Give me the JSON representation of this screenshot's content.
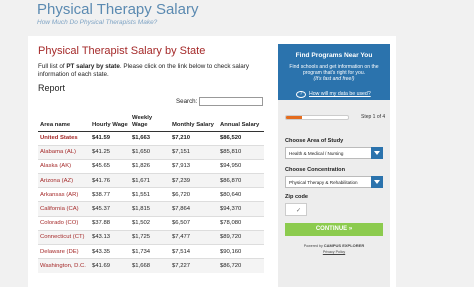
{
  "header": {
    "title": "Physical Therapy Salary",
    "subtitle": "How Much Do Physical Therapists Make?"
  },
  "article": {
    "heading": "Physical Therapist Salary by State",
    "intro_prefix": "Full list of ",
    "intro_bold": "PT salary by state",
    "intro_suffix": ". Please click on the link below to check salary information of each state.",
    "report_label": "Report",
    "search_label": "Search:",
    "search_value": ""
  },
  "table": {
    "columns": [
      "Area name",
      "Hourly Wage",
      "Weekly Wage",
      "Monthly Salary",
      "Annual Salary"
    ],
    "rows": [
      [
        "United States",
        "$41.59",
        "$1,663",
        "$7,210",
        "$86,520"
      ],
      [
        "Alabama (AL)",
        "$41.25",
        "$1,650",
        "$7,151",
        "$85,810"
      ],
      [
        "Alaska (AK)",
        "$45.65",
        "$1,826",
        "$7,913",
        "$94,950"
      ],
      [
        "Arizona (AZ)",
        "$41.76",
        "$1,671",
        "$7,239",
        "$86,870"
      ],
      [
        "Arkansas (AR)",
        "$38.77",
        "$1,551",
        "$6,720",
        "$80,640"
      ],
      [
        "California (CA)",
        "$45.37",
        "$1,815",
        "$7,864",
        "$94,370"
      ],
      [
        "Colorado (CO)",
        "$37.88",
        "$1,502",
        "$6,507",
        "$78,080"
      ],
      [
        "Connecticut (CT)",
        "$43.13",
        "$1,725",
        "$7,477",
        "$89,720"
      ],
      [
        "Delaware (DE)",
        "$43.35",
        "$1,734",
        "$7,514",
        "$90,160"
      ],
      [
        "Washington, D.C.",
        "$41.69",
        "$1,668",
        "$7,227",
        "$86,720"
      ]
    ]
  },
  "widget": {
    "title": "Find Programs Near You",
    "text": "Find schools and get information on the program that's right for you.",
    "text_italic": "(It's fast and free!)",
    "help_icon_glyph": "?",
    "help_link": "How will my data be used?",
    "progress_fraction": 0.25,
    "step_text": "Step 1 of 4",
    "area_label": "Choose Area of Study",
    "area_value": "Health & Medical / Nursing",
    "concentration_label": "Choose Concentration",
    "concentration_value": "Physical Therapy & Rehabilitation",
    "zip_label": "Zip code",
    "zip_check": "✓",
    "cta": "CONTINUE »",
    "powered_prefix": "Powered by",
    "powered_brand": "CAMPUS EXPLORER",
    "privacy": "Privacy Policy"
  },
  "colors": {
    "accent_blue": "#2b73ad",
    "state_link": "#a52a2a",
    "cta_green": "#8ccb4e",
    "progress_orange": "#e46c1e"
  }
}
